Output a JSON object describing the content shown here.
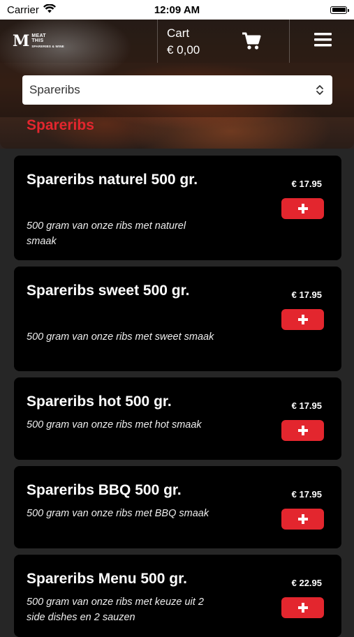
{
  "status_bar": {
    "carrier": "Carrier",
    "time": "12:09 AM"
  },
  "header": {
    "logo": {
      "line1": "MEAT",
      "line2": "THIS",
      "tagline": "SPARERIBS & WINE"
    },
    "cart_label": "Cart",
    "cart_total": "€ 0,00"
  },
  "category_select": {
    "selected": "Spareribs"
  },
  "category_title": "Spareribs",
  "colors": {
    "accent": "#e3262e",
    "card_bg": "#000000",
    "page_bg": "#262626"
  },
  "products": [
    {
      "name": "Spareribs naturel 500 gr.",
      "description": "500 gram van onze ribs met naturel smaak",
      "price": "€ 17.95"
    },
    {
      "name": "Spareribs sweet 500 gr.",
      "description": "500 gram van onze ribs met sweet smaak",
      "price": "€ 17.95"
    },
    {
      "name": "Spareribs hot 500 gr.",
      "description": "500 gram van onze ribs met hot smaak",
      "price": "€ 17.95"
    },
    {
      "name": "Spareribs BBQ 500 gr.",
      "description": "500 gram van onze ribs met BBQ smaak",
      "price": "€ 17.95"
    },
    {
      "name": "Spareribs Menu 500 gr.",
      "description": "500 gram van onze ribs met keuze uit 2 side dishes en 2 sauzen",
      "price": "€ 22.95"
    }
  ]
}
